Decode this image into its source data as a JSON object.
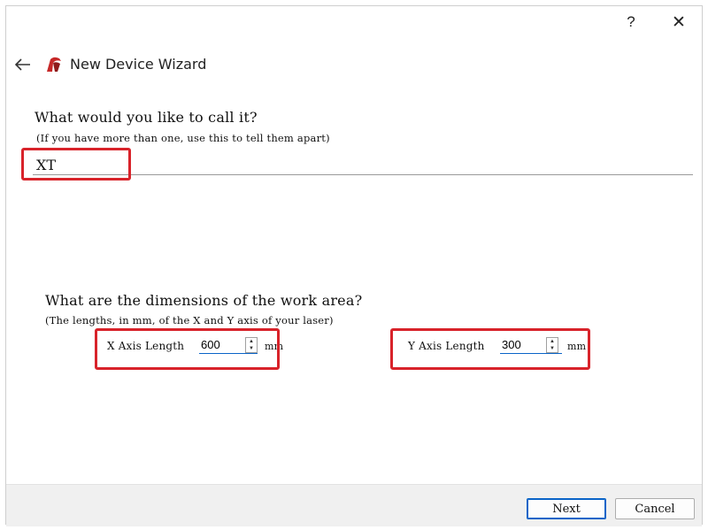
{
  "titlebar": {
    "help_label": "?",
    "close_label": "✕"
  },
  "header": {
    "back_icon": "back-arrow-icon",
    "app_icon": "laser-app-icon",
    "title": "New Device Wizard"
  },
  "name_section": {
    "question": "What would you like to call it?",
    "hint": "(If you have more than one, use this to tell them apart)",
    "value": "XT"
  },
  "dimensions_section": {
    "question": "What are the dimensions of the work area?",
    "hint": "(The lengths, in mm, of the X and Y axis of your laser)",
    "x_axis": {
      "label": "X Axis Length",
      "value": "600",
      "unit": "mm"
    },
    "y_axis": {
      "label": "Y Axis Length",
      "value": "300",
      "unit": "mm"
    }
  },
  "footer": {
    "next_label": "Next",
    "cancel_label": "Cancel"
  },
  "colors": {
    "highlight": "#d8232a",
    "focus": "#0a64c8"
  }
}
